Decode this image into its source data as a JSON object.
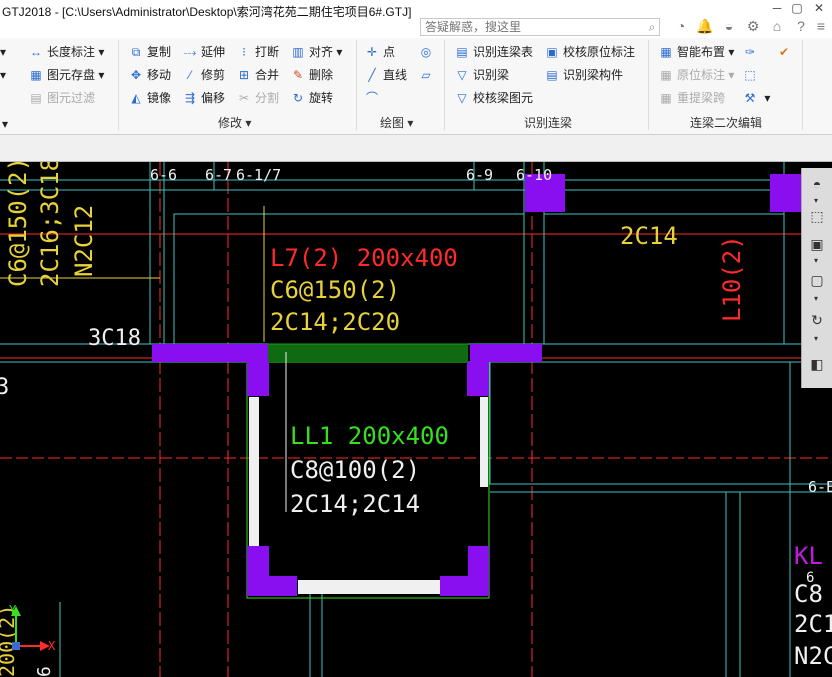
{
  "window": {
    "title": "GTJ2018 - [C:\\Users\\Administrator\\Desktop\\索河湾花苑二期住宅项目6#.GTJ]",
    "search_placeholder": "答疑解惑，搜这里",
    "minimize": "─",
    "restore": "▢",
    "close": "✕"
  },
  "ribbon": {
    "left_partial": {
      "length_mark": "长度标注",
      "element_save": "图元存盘",
      "element_filter": "图元过滤"
    },
    "modify": {
      "label": "修改",
      "copy": "复制",
      "extend": "延伸",
      "break": "打断",
      "align": "对齐",
      "move": "移动",
      "trim": "修剪",
      "merge": "合并",
      "delete": "删除",
      "mirror": "镜像",
      "offset": "偏移",
      "split": "分割",
      "rotate": "旋转"
    },
    "draw": {
      "label": "绘图",
      "point": "点",
      "line": "直线"
    },
    "identify": {
      "label": "识别连梁",
      "table": "识别连梁表",
      "identify_beam": "识别梁",
      "check_figure": "校核梁图元",
      "check_orig": "校核原位标注",
      "identify_member": "识别梁构件"
    },
    "secondary": {
      "label": "连梁二次编辑",
      "smart": "智能布置",
      "orig_mark": "原位标注",
      "relift": "重提梁跨"
    }
  },
  "canvas": {
    "axis_labels": [
      "6-6",
      "6-7",
      "6-1/7",
      "6-9",
      "6-10",
      "6-E"
    ],
    "texts": {
      "left_v1": "C6@150(2)",
      "left_v2": "2C16;3C18",
      "left_v3": "N2C12",
      "left_3c18": "3C18",
      "left_small": "3",
      "l7_title": "L7(2) 200x400",
      "l7_stirrup": "C6@150(2)",
      "l7_bars": "2C14;2C20",
      "right_2c14": "2C14",
      "l10": "L10(2)",
      "ll1_title": "LL1 200x400",
      "ll1_stirrup": "C8@100(2)",
      "ll1_bars": "2C14;2C14",
      "kl": "KL",
      "r_c8": "C8",
      "r_2c1": "2C1",
      "r_n2c": "N2C",
      "r_6": "6",
      "bl_v": "200(2)",
      "bl_6": "6"
    },
    "coord": {
      "y": "Y",
      "x": "X"
    }
  },
  "colors": {
    "red": "#ff2a2a",
    "yellow": "#e8d23a",
    "green": "#36e01f",
    "white": "#f0f0f0",
    "cyan": "#3fc2c2",
    "magenta": "#c01ae0",
    "purple": "#8a0ff0",
    "darkgreen": "#0f6a12",
    "slab_green": "#18a018"
  }
}
